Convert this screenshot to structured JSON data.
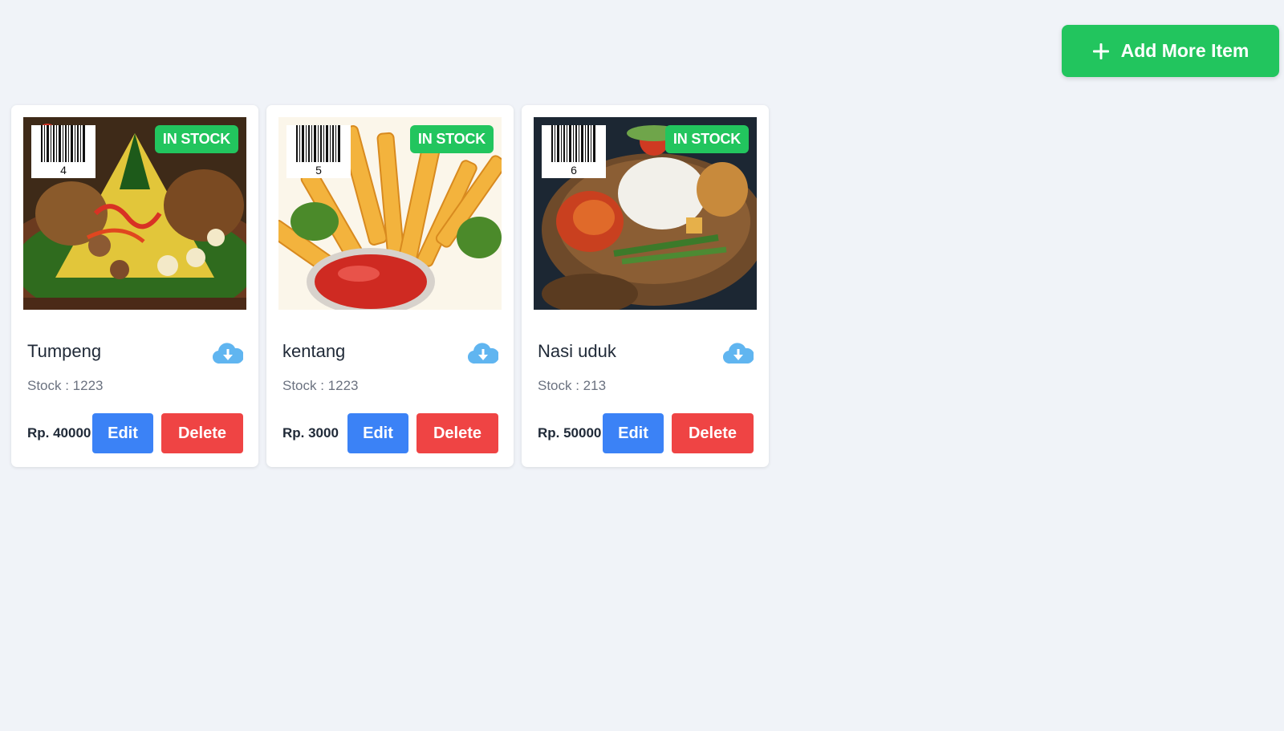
{
  "header": {
    "add_button_label": "Add More Item",
    "add_button_icon": "plus-icon",
    "accent_color": "#22c55e"
  },
  "items": [
    {
      "barcode_number": "4",
      "badge": "IN STOCK",
      "name": "Tumpeng",
      "stock": "Stock : 1223",
      "price": "Rp. 40000",
      "edit_label": "Edit",
      "delete_label": "Delete",
      "download_icon": "cloud-download-icon"
    },
    {
      "barcode_number": "5",
      "badge": "IN STOCK",
      "name": "kentang",
      "stock": "Stock : 1223",
      "price": "Rp. 3000",
      "edit_label": "Edit",
      "delete_label": "Delete",
      "download_icon": "cloud-download-icon"
    },
    {
      "barcode_number": "6",
      "badge": "IN STOCK",
      "name": "Nasi uduk",
      "stock": "Stock : 213",
      "price": "Rp. 50000",
      "edit_label": "Edit",
      "delete_label": "Delete",
      "download_icon": "cloud-download-icon"
    }
  ],
  "colors": {
    "edit": "#3b82f6",
    "delete": "#ef4444",
    "badge": "#22c55e",
    "download_icon": "#60b5f0"
  }
}
